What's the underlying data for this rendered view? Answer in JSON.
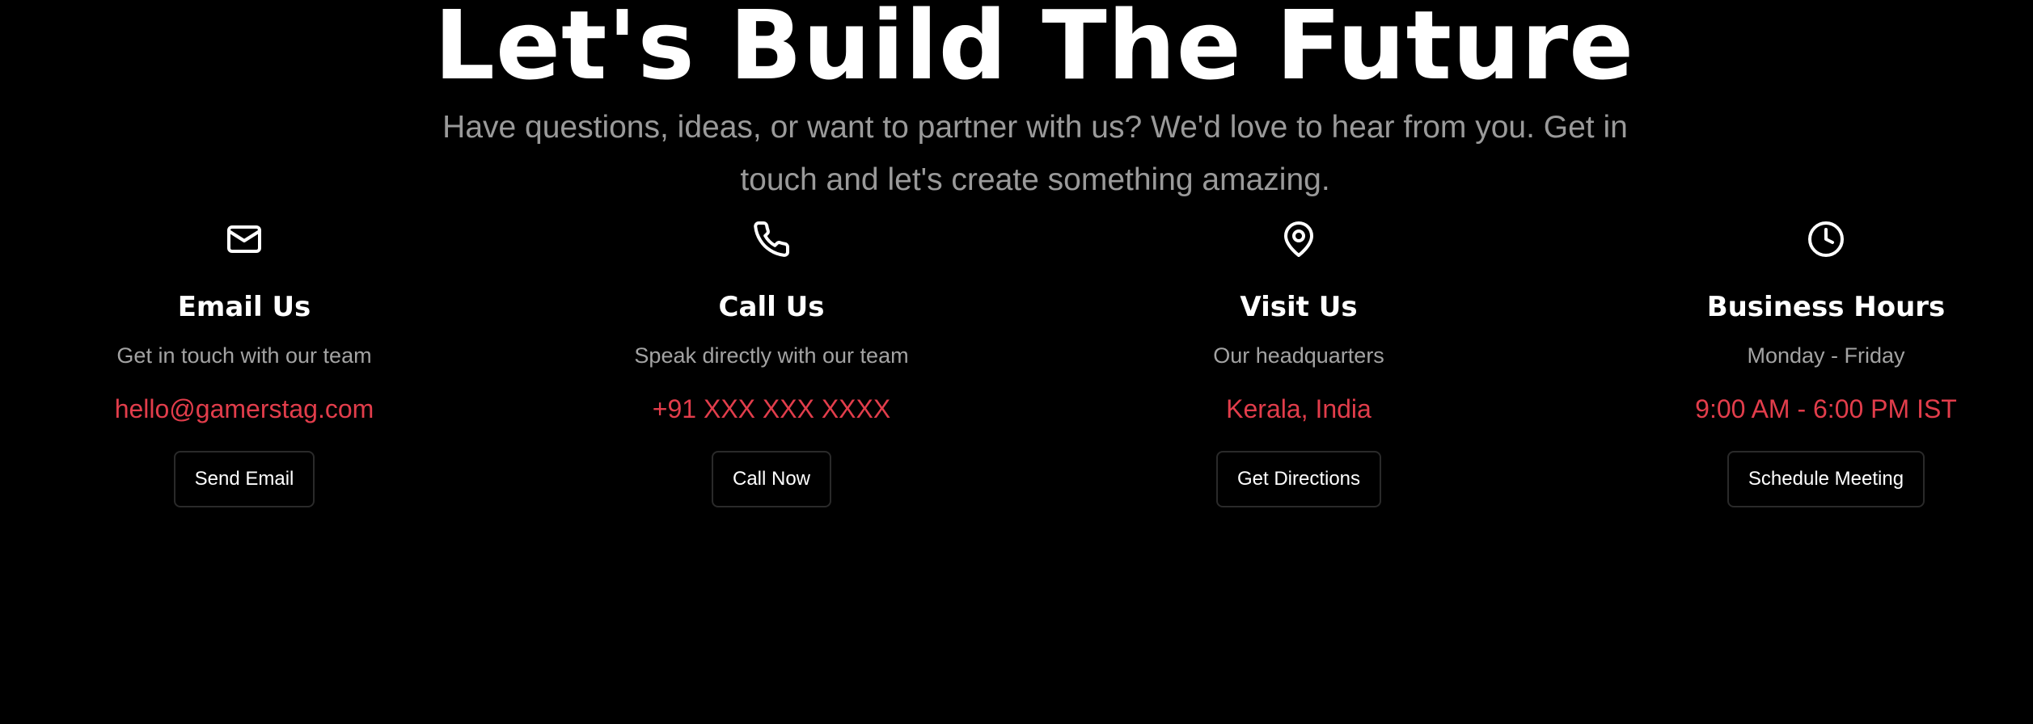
{
  "hero": {
    "title": "Let's Build The Future",
    "subtitle": "Have questions, ideas, or want to partner with us? We'd love to hear from you. Get in touch and let's create something amazing."
  },
  "colors": {
    "background": "#000000",
    "accent": "#e23d4b",
    "muted_text": "#a3a3a3"
  },
  "contact_cards": [
    {
      "icon": "mail-icon",
      "title": "Email Us",
      "description": "Get in touch with our team",
      "value": "hello@gamerstag.com",
      "button": "Send Email"
    },
    {
      "icon": "phone-icon",
      "title": "Call Us",
      "description": "Speak directly with our team",
      "value": "+91 XXX XXX XXXX",
      "button": "Call Now"
    },
    {
      "icon": "map-pin-icon",
      "title": "Visit Us",
      "description": "Our headquarters",
      "value": "Kerala, India",
      "button": "Get Directions"
    },
    {
      "icon": "clock-icon",
      "title": "Business Hours",
      "description": "Monday - Friday",
      "value": "9:00 AM - 6:00 PM IST",
      "button": "Schedule Meeting"
    }
  ]
}
